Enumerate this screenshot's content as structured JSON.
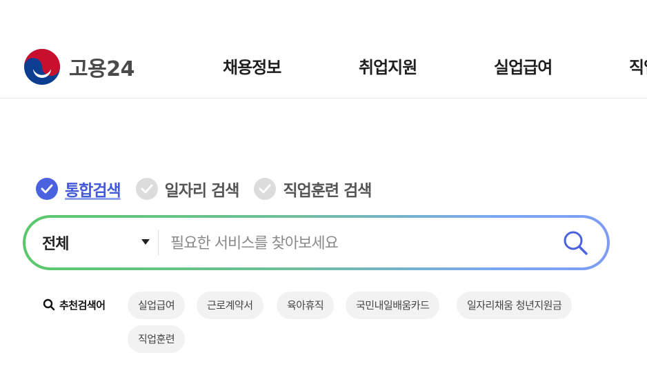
{
  "header": {
    "logo_text": "고용24",
    "nav": [
      "채용정보",
      "취업지원",
      "실업급여",
      "직업"
    ]
  },
  "search": {
    "tabs": [
      {
        "label": "통합검색",
        "active": true
      },
      {
        "label": "일자리 검색",
        "active": false
      },
      {
        "label": "직업훈련 검색",
        "active": false
      }
    ],
    "scope_value": "전체",
    "placeholder": "필요한 서비스를 찾아보세요",
    "recommend_label": "추천검색어",
    "keywords": [
      "실업급여",
      "근로계약서",
      "육아휴직",
      "국민내일배움카드",
      "일자리채움 청년지원금",
      "직업훈련"
    ]
  },
  "colors": {
    "accent": "#4a62e0",
    "gradient_start": "#59c86a",
    "gradient_end": "#7f9cf5",
    "chip_bg": "#f2f2f2"
  }
}
